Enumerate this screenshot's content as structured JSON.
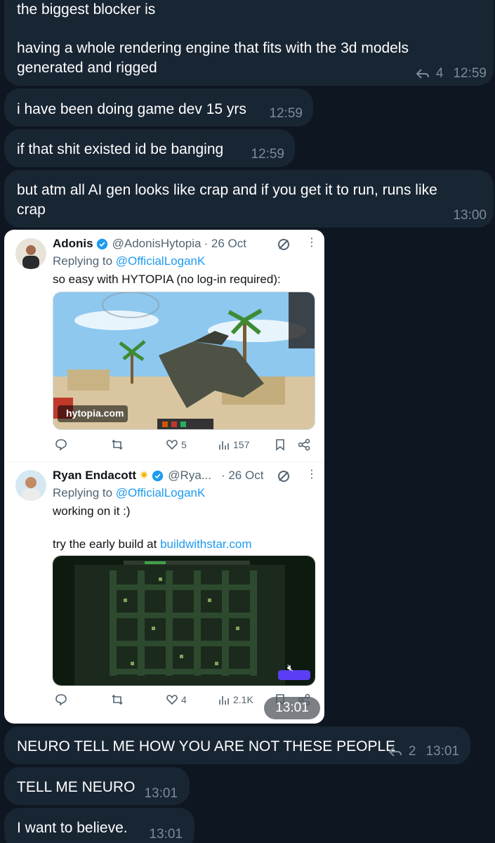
{
  "messages": [
    {
      "id": "m1",
      "lines": [
        "the biggest blocker is",
        "",
        "having a whole rendering engine that fits with the 3d models",
        "generated and rigged"
      ],
      "replies": "4",
      "time": "12:59"
    },
    {
      "id": "m2",
      "text": "i have been doing game dev 15 yrs",
      "time": "12:59"
    },
    {
      "id": "m3",
      "text": "if that shit existed id be banging",
      "time": "12:59"
    },
    {
      "id": "m4",
      "lines": [
        "but atm all AI gen looks like crap and if you get it to run, runs like",
        "crap"
      ],
      "time": "13:00"
    },
    {
      "id": "m6",
      "text": "NEURO TELL ME HOW YOU ARE NOT THESE PEOPLE",
      "replies": "2",
      "time": "13:01"
    },
    {
      "id": "m7",
      "text": "TELL ME NEURO",
      "time": "13:01"
    },
    {
      "id": "m8",
      "text": "I want to believe.",
      "time": "13:01"
    }
  ],
  "photo_time": "13:01",
  "tweets": [
    {
      "name": "Adonis",
      "handle": "@AdonisHytopia",
      "date": "· 26 Oct",
      "replying_prefix": "Replying to",
      "replying_to": "@OfficialLoganK",
      "text": "so easy with HYTOPIA (no log-in required):",
      "media_label": "hytopia.com",
      "likes": "5",
      "views": "157"
    },
    {
      "name": "Ryan Endacott",
      "handle": "@Rya...",
      "date": "· 26 Oct",
      "replying_prefix": "Replying to",
      "replying_to": "@OfficialLoganK",
      "text": "working on it :)",
      "text2_prefix": "try the early build at",
      "text2_link": "buildwithstar.com",
      "likes": "4",
      "views": "2.1K"
    }
  ],
  "colors": {
    "background": "#0e1621",
    "bubble": "#182533",
    "meta": "#7d8b99",
    "link": "#1d9bf0"
  }
}
